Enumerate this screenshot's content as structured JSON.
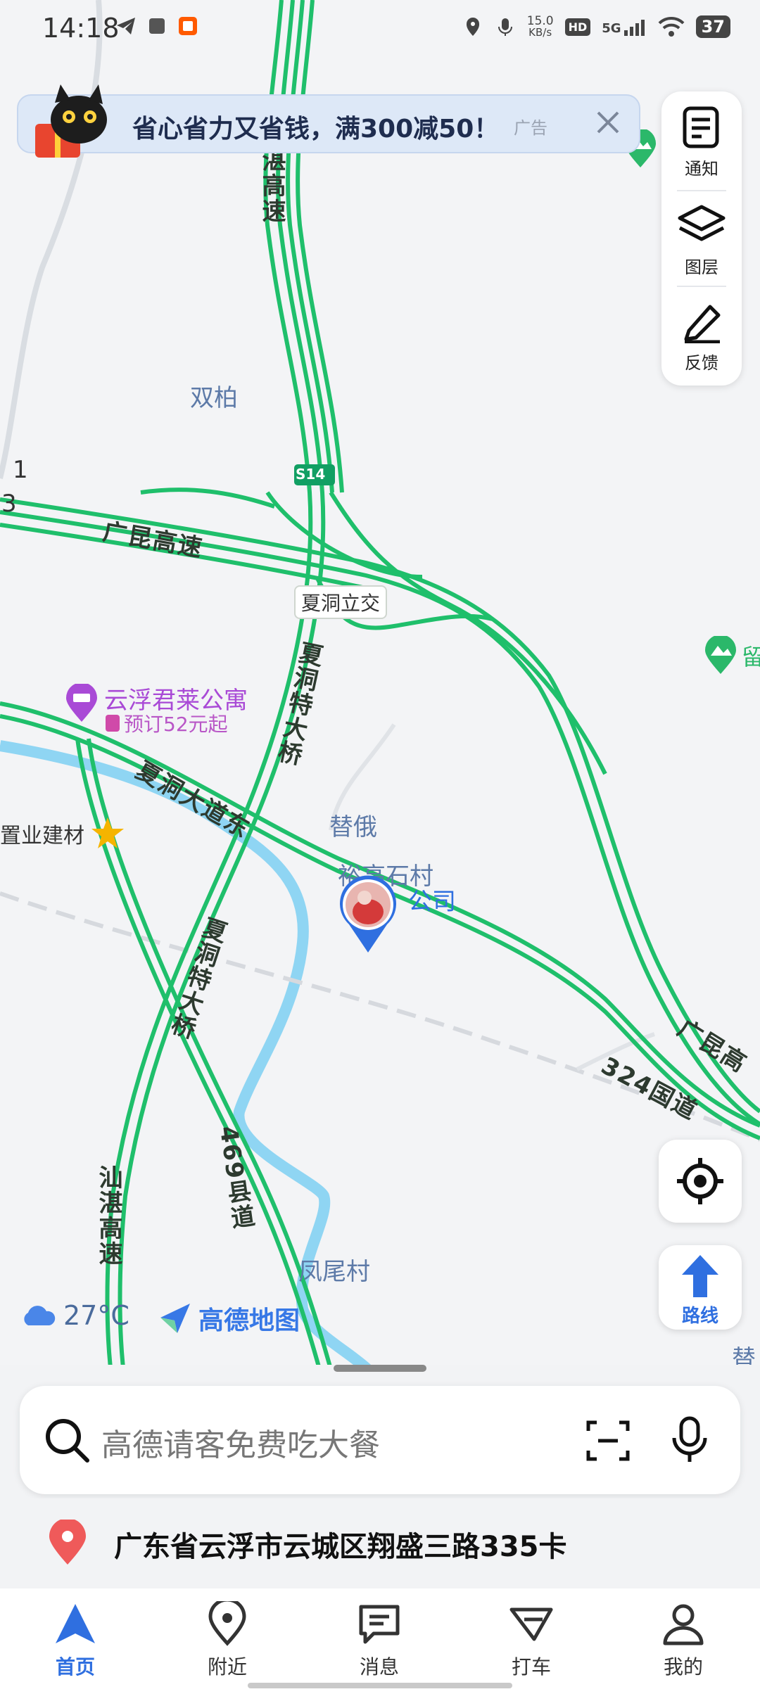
{
  "status_bar": {
    "time": "14:18",
    "net_speed_value": "15.0",
    "net_speed_unit": "KB/s",
    "hd": "HD",
    "signal": "5G",
    "battery": "37"
  },
  "ad_banner": {
    "text": "省心省力又省钱，满300减50！",
    "tag": "广告"
  },
  "map_tools": {
    "notice_label": "通知",
    "layers_label": "图层",
    "feedback_label": "反馈"
  },
  "map_labels": {
    "village_shuangbai": "双柏",
    "highway_guangkun_top": "广昆高速",
    "highway_shanzhan_top": "湛高速",
    "highway_s14": "S14",
    "interchange": "夏洞立交",
    "bridge_upper": "夏洞特大桥",
    "hotel_name": "云浮君莱公寓",
    "hotel_promo": "预订52元起",
    "road_xiadong": "夏洞大道东",
    "shop": "置业建材",
    "village_jie_e": "替俄",
    "village_yugao": "裕高石村",
    "company": "公司",
    "bridge_lower": "夏洞特大桥",
    "road_324": "324国道",
    "highway_guangkun_right": "广昆高",
    "county_road": "469县道",
    "highway_shanzhan_bottom": "汕湛高速",
    "village_fengwei": "凤尾村",
    "edge_right_top": "留",
    "edge_right_bottom": "替",
    "edge_left_1": "1",
    "edge_left_3": "3"
  },
  "route_button_label": "路线",
  "weather": {
    "temperature": "27°C"
  },
  "brand": "高德地图",
  "search": {
    "placeholder": "高德请客免费吃大餐"
  },
  "current_location": "广东省云浮市云城区翔盛三路335卡",
  "bottom_nav": [
    {
      "label": "首页"
    },
    {
      "label": "附近"
    },
    {
      "label": "消息"
    },
    {
      "label": "打车"
    },
    {
      "label": "我的"
    }
  ],
  "colors": {
    "road_green": "#1fbf6b",
    "river_blue": "#8fd5f3",
    "accent_blue": "#2f6fe0"
  }
}
